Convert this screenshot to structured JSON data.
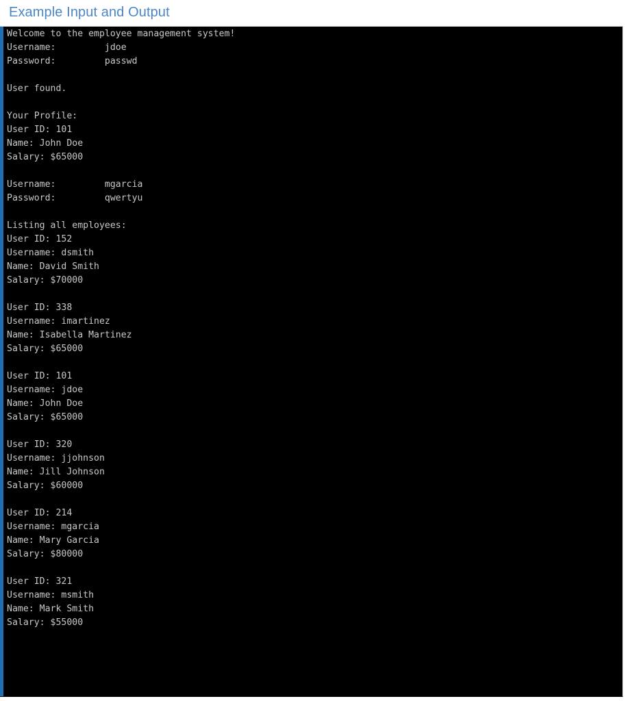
{
  "page": {
    "background_color": "#ffffff"
  },
  "heading": {
    "text": "Example Input and Output",
    "color": "#4a86c8"
  },
  "console": {
    "background_color": "#000000",
    "text_color": "#c9c9c9",
    "accent_bar_color": "#1f6fb5",
    "border_color": "#c8c8c8",
    "lines": [
      "Welcome to the employee management system!",
      "Username:         jdoe",
      "Password:         passwd",
      "",
      "User found.",
      "",
      "Your Profile:",
      "User ID: 101",
      "Name: John Doe",
      "Salary: $65000",
      "",
      "Username:         mgarcia",
      "Password:         qwertyu",
      "",
      "Listing all employees:",
      "User ID: 152",
      "Username: dsmith",
      "Name: David Smith",
      "Salary: $70000",
      "",
      "User ID: 338",
      "Username: imartinez",
      "Name: Isabella Martinez",
      "Salary: $65000",
      "",
      "User ID: 101",
      "Username: jdoe",
      "Name: John Doe",
      "Salary: $65000",
      "",
      "User ID: 320",
      "Username: jjohnson",
      "Name: Jill Johnson",
      "Salary: $60000",
      "",
      "User ID: 214",
      "Username: mgarcia",
      "Name: Mary Garcia",
      "Salary: $80000",
      "",
      "User ID: 321",
      "Username: msmith",
      "Name: Mark Smith",
      "Salary: $55000"
    ],
    "session": {
      "greeting": "Welcome to the employee management system!",
      "login_attempts": [
        {
          "username_label": "Username:",
          "username_value": "jdoe",
          "password_label": "Password:",
          "password_value": "passwd"
        },
        {
          "username_label": "Username:",
          "username_value": "mgarcia",
          "password_label": "Password:",
          "password_value": "qwertyu"
        }
      ],
      "status_message": "User found.",
      "profile_header": "Your Profile:",
      "profile": {
        "user_id": "101",
        "name": "John Doe",
        "salary": "$65000"
      },
      "listing_header": "Listing all employees:",
      "employees": [
        {
          "user_id": "152",
          "username": "dsmith",
          "name": "David Smith",
          "salary": "$70000"
        },
        {
          "user_id": "338",
          "username": "imartinez",
          "name": "Isabella Martinez",
          "salary": "$65000"
        },
        {
          "user_id": "101",
          "username": "jdoe",
          "name": "John Doe",
          "salary": "$65000"
        },
        {
          "user_id": "320",
          "username": "jjohnson",
          "name": "Jill Johnson",
          "salary": "$60000"
        },
        {
          "user_id": "214",
          "username": "mgarcia",
          "name": "Mary Garcia",
          "salary": "$80000"
        },
        {
          "user_id": "321",
          "username": "msmith",
          "name": "Mark Smith",
          "salary": "$55000"
        }
      ]
    }
  }
}
